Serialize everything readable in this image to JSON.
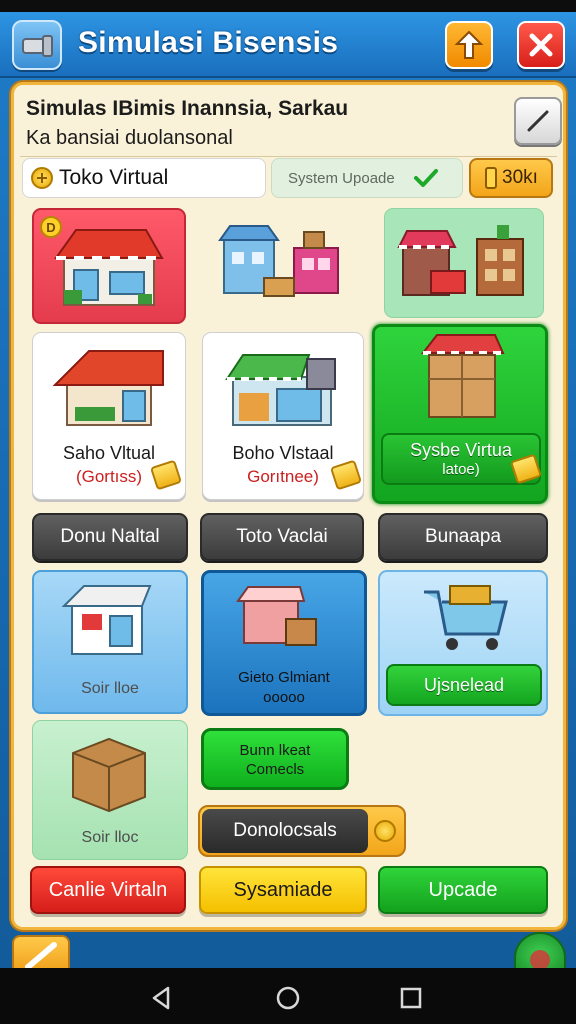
{
  "header": {
    "title": "Simulasi Bisensis",
    "colors": {
      "bar": "#1a6fbd",
      "up_button": "#f08a00",
      "close_button": "#d81f1a"
    }
  },
  "info": {
    "title": "Simulas IBimis Inannsia, Sarkau",
    "subtitle": "Ka bansiai duolansonal"
  },
  "toolbar": {
    "shop_label": "Toko Virtual",
    "system_label": "System Upoade",
    "coins": "30kı"
  },
  "cards": [
    {
      "name": "Saho Vltual",
      "sub": "(Gortıss)"
    },
    {
      "name": "Boho Vlstaal",
      "sub": "Gorıtnee)"
    },
    {
      "name": "Sysbe Virtua",
      "sub": "latoe)"
    }
  ],
  "gray_buttons": [
    "Donu Naltal",
    "Toto Vaclai",
    "Bunaapa"
  ],
  "row3": {
    "left_caption": "Soir lloe",
    "mid_name": "Gieto Glmiant",
    "mid_sub": "ooooo",
    "right_button": "Ujsnelead"
  },
  "row4": {
    "left_caption": "Soir lloc",
    "bulk_line1": "Bunn lkeat",
    "bulk_line2": "Comecls",
    "wholesale": "Donolocsals"
  },
  "bottom_buttons": [
    "Canlie Virtaln",
    "Sysamiade",
    "Upcade"
  ]
}
